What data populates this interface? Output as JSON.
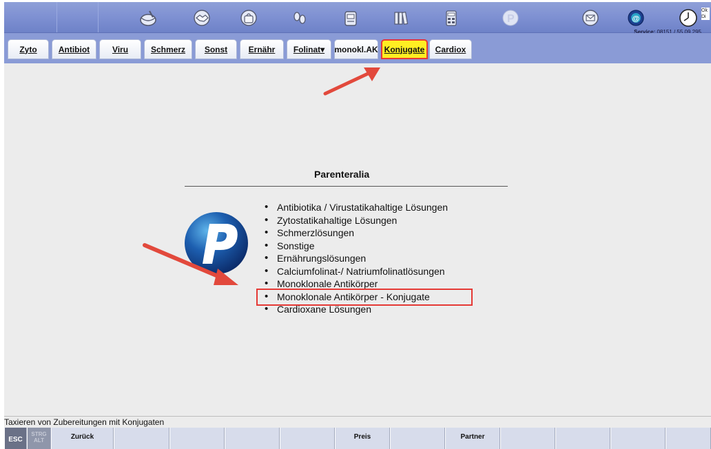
{
  "toolbar": {
    "icons": [
      "mortar-icon",
      "handshake-icon",
      "bag-icon",
      "footprints-icon",
      "printer-icon",
      "books-icon",
      "calculator-icon",
      "parenteralia-logo-icon",
      "mail-icon",
      "at-icon",
      "clock-icon"
    ],
    "service_label": "Service:",
    "service_number": "08151 / 55 09 295",
    "clock_side_text": "Ok Di"
  },
  "tabs": [
    {
      "label": "Zyto",
      "active": false
    },
    {
      "label": "Antibiot",
      "active": false
    },
    {
      "label": "Viru",
      "active": false
    },
    {
      "label": "Schmerz",
      "active": false
    },
    {
      "label": "Sonst",
      "active": false
    },
    {
      "label": "Ernähr",
      "active": false
    },
    {
      "label": "Folinat▾",
      "active": false
    },
    {
      "label": "monokl.AK",
      "active": false
    },
    {
      "label": "Konjugate",
      "active": true
    },
    {
      "label": "Cardiox",
      "active": false
    }
  ],
  "main": {
    "heading": "Parenteralia",
    "items": [
      "Antibiotika / Virustatikahaltige Lösungen",
      "Zytostatikahaltige Lösungen",
      "Schmerzlösungen",
      "Sonstige",
      "Ernährungslösungen",
      "Calciumfolinat-/ Natriumfolinatlösungen",
      "Monoklonale Antikörper",
      "Monoklonale Antikörper - Konjugate",
      "Cardioxane Lösungen"
    ],
    "highlighted_index": 7
  },
  "status_text": "Taxieren von Zubereitungen mit Konjugaten",
  "fkeys": {
    "esc": "ESC",
    "strg_alt": "STRG ALT",
    "f1": "Zurück",
    "f5": "Preis",
    "f7": "Partner"
  },
  "colors": {
    "toolbar": "#7e90d2",
    "active_tab": "#ffee22",
    "highlight": "#e53935",
    "content_bg": "#ececec"
  }
}
